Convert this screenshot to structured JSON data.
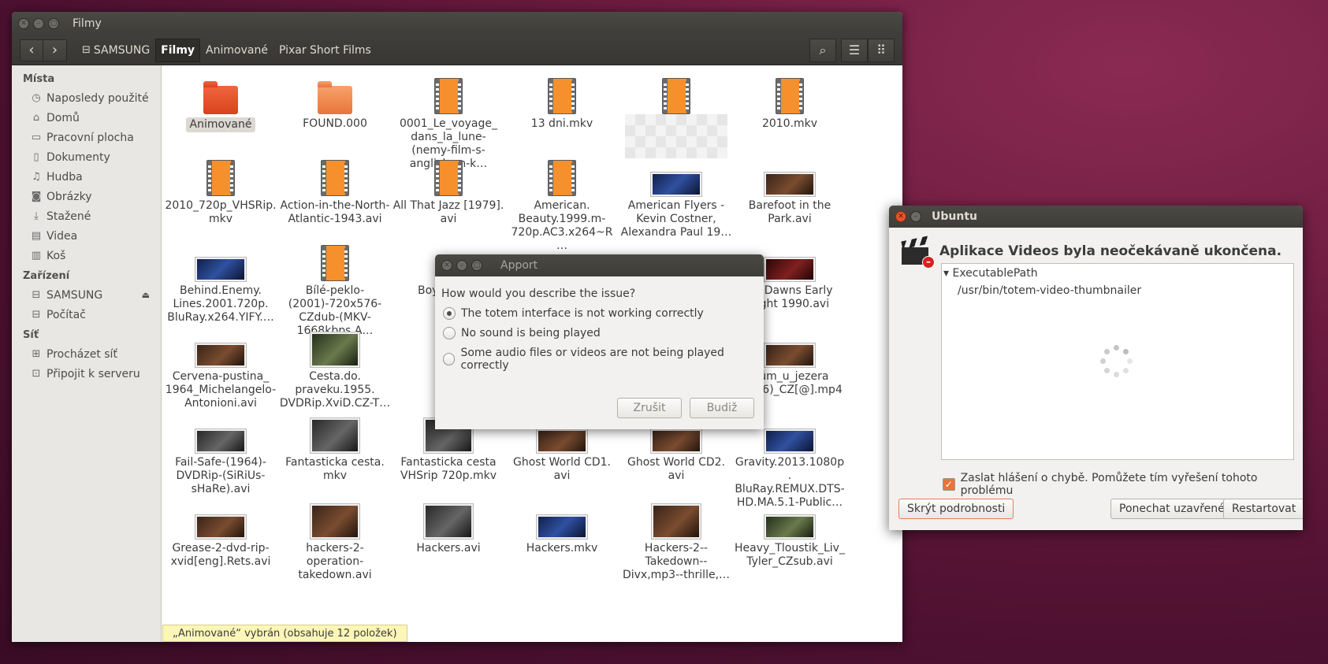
{
  "nautilus": {
    "title": "Filmy",
    "path": [
      {
        "label": "SAMSUNG",
        "drive": true
      },
      {
        "label": "Filmy",
        "current": true
      },
      {
        "label": "Animované"
      },
      {
        "label": "Pixar Short Films"
      }
    ],
    "sidebar": {
      "places_header": "Místa",
      "places": [
        {
          "label": "Naposledy použité",
          "icon": "clock-icon"
        },
        {
          "label": "Domů",
          "icon": "home-icon"
        },
        {
          "label": "Pracovní plocha",
          "icon": "folder-icon"
        },
        {
          "label": "Dokumenty",
          "icon": "document-icon"
        },
        {
          "label": "Hudba",
          "icon": "music-icon"
        },
        {
          "label": "Obrázky",
          "icon": "camera-icon"
        },
        {
          "label": "Stažené",
          "icon": "download-icon"
        },
        {
          "label": "Videa",
          "icon": "film-icon"
        },
        {
          "label": "Koš",
          "icon": "trash-icon"
        }
      ],
      "devices_header": "Zařízení",
      "devices": [
        {
          "label": "SAMSUNG",
          "icon": "drive-icon",
          "eject": true
        },
        {
          "label": "Počítač",
          "icon": "drive-icon"
        }
      ],
      "network_header": "Síť",
      "network": [
        {
          "label": "Procházet síť",
          "icon": "network-icon"
        },
        {
          "label": "Připojit k serveru",
          "icon": "server-icon"
        }
      ]
    },
    "files": [
      [
        "Animované",
        "FOUND.000",
        "0001_Le_voyage_ dans_la_lune-(nemy-film-s-anglickym-k…",
        "13 dni.mkv",
        "",
        "2010.mkv"
      ],
      [
        "2010_720p_VHSRip. mkv",
        "Action-in-the-North-Atlantic-1943.avi",
        "All That Jazz [1979]. avi",
        "American. Beauty.1999.m-720p.AC3.x264~R…",
        "American Flyers - Kevin Costner, Alexandra Paul 19…",
        "Barefoot in the Park.avi"
      ],
      [
        "Behind.Enemy. Lines.2001.720p. BluRay.x264.YIFY.…",
        "Bílé-peklo-(2001)-720x576-CZdub-(MKV-1668kbps,A…",
        "Boy… Up…",
        "",
        "",
        "By Dawns Early Light 1990.avi"
      ],
      [
        "Cervena-pustina_ 1964_Michelangelo-Antonioni.avi",
        "Cesta.do. praveku.1955. DVDRip.XviD.CZ-T…",
        "C…",
        "",
        "…",
        "Dům_u_jezera (2006)_CZ[@].mp4"
      ],
      [
        "Fail-Safe-(1964)-DVDRip-(SiRiUs-sHaRe).avi",
        "Fantasticka cesta. mkv",
        "Fantasticka cesta VHSrip 720p.mkv",
        "Ghost World CD1. avi",
        "Ghost World CD2. avi",
        "Gravity.2013.1080p. BluRay.REMUX.DTS-HD.MA.5.1-Public…"
      ],
      [
        "Grease-2-dvd-rip-xvid[eng].Rets.avi",
        "hackers-2-operation-takedown.avi",
        "Hackers.avi",
        "Hackers.mkv",
        "Hackers-2--Takedown--Divx,mp3--thrille,…",
        "Heavy_Tloustik_Liv_ Tyler_CZsub.avi"
      ]
    ],
    "status": "„Animované“ vybrán  (obsahuje 12 položek)"
  },
  "apport": {
    "title": "Apport",
    "question": "How would you describe the issue?",
    "options": [
      "The totem interface is not working correctly",
      "No sound is being played",
      "Some audio files or videos are not being played correctly"
    ],
    "selected": 0,
    "cancel": "Zrušit",
    "ok": "Budiž"
  },
  "crash": {
    "title": "Ubuntu",
    "heading": "Aplikace Videos byla neočekávaně ukončena.",
    "detail_key": "ExecutablePath",
    "detail_value": "/usr/bin/totem-video-thumbnailer",
    "checkbox": "Zaslat hlášení o chybě. Pomůžete tím vyřešení tohoto problému",
    "hide_details": "Skrýt podrobnosti",
    "keep_closed": "Ponechat uzavřené",
    "restart": "Restartovat"
  },
  "colors": {
    "accent": "#e9743a",
    "titlebar": "#3e3d39",
    "status": "#fcf6b8"
  }
}
